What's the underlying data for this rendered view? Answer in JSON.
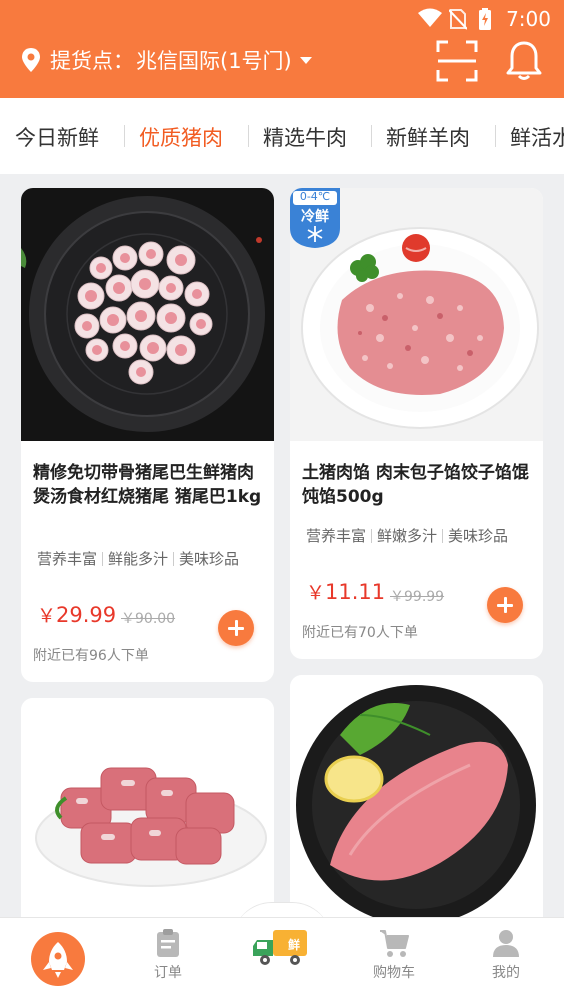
{
  "status": {
    "time": "7:00"
  },
  "header": {
    "location_label": "提货点：",
    "location_name": "兆信国际(1号门)",
    "accent": "#f87a3e",
    "icons": [
      "location-pin-icon",
      "scan-icon",
      "bell-icon"
    ]
  },
  "tabs": [
    {
      "label": "今日新鲜",
      "active": false
    },
    {
      "label": "优质猪肉",
      "active": true
    },
    {
      "label": "精选牛肉",
      "active": false
    },
    {
      "label": "新鲜羊肉",
      "active": false
    },
    {
      "label": "鲜活水",
      "active": false
    }
  ],
  "products": [
    {
      "title": "精修免切带骨猪尾巴生鲜猪肉 煲汤食材红烧猪尾 猪尾巴1kg",
      "tags": [
        "营养丰富",
        "鲜能多汁",
        "美味珍品"
      ],
      "currency": "￥",
      "price": "29.99",
      "original_price": "￥90.00",
      "sold": "附近已有96人下单"
    },
    {
      "badge_temp": "0-4℃",
      "badge_label": "冷鲜",
      "title": "土猪肉馅 肉末包子馅饺子馅馄饨馅500g",
      "tags": [
        "营养丰富",
        "鲜嫩多汁",
        "美味珍品"
      ],
      "currency": "￥",
      "price": "11.11",
      "original_price": "￥99.99",
      "sold": "附近已有70人下单"
    },
    {
      "title": "",
      "image": "pork-ribs-image"
    },
    {
      "title": "",
      "image": "pork-tenderloin-image"
    }
  ],
  "bottom_nav": {
    "items": [
      {
        "label": "",
        "icon": "rocket-icon",
        "active": true
      },
      {
        "label": "订单",
        "icon": "order-clipboard-icon"
      },
      {
        "label": "",
        "icon": "delivery-truck-icon",
        "badge": "鲜"
      },
      {
        "label": "购物车",
        "icon": "cart-icon"
      },
      {
        "label": "我的",
        "icon": "user-icon"
      }
    ]
  },
  "colors": {
    "accent": "#f87a3e",
    "price_red": "#e8382a",
    "active_tab": "#f25c22"
  }
}
